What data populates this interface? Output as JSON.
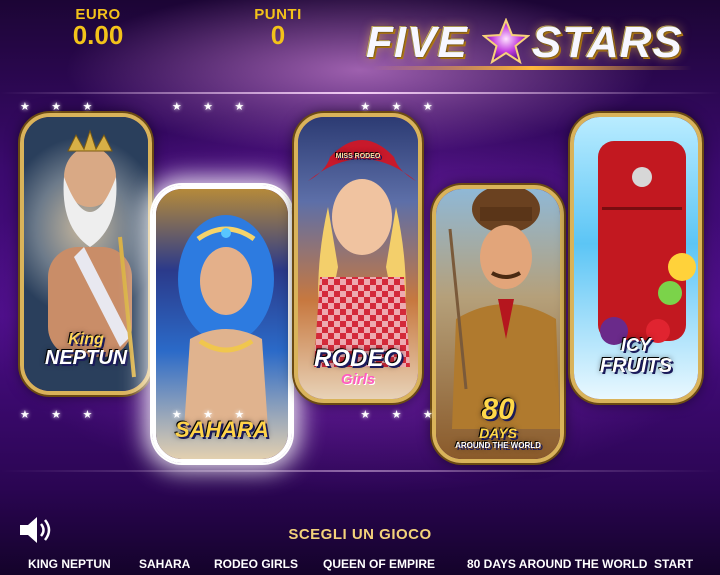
{
  "hud": {
    "credit_label": "EURO",
    "credit_value": "0.00",
    "points_label": "PUNTI",
    "points_value": "0"
  },
  "logo": {
    "left_word": "FIVE",
    "right_word": "STARS"
  },
  "games": [
    {
      "title_line1": "King",
      "title_line2": "NEPTUN",
      "selected": false
    },
    {
      "title_line1": "SAHARA",
      "selected": true
    },
    {
      "title_line1": "RODEO",
      "title_line2": "Girls",
      "badge": "MISS RODEO",
      "selected": false
    },
    {
      "title_line1": "80",
      "title_line2": "DAYS",
      "title_line3": "AROUND THE WORLD",
      "selected": false
    },
    {
      "title_line1": "ICY",
      "title_line2": "FRUITS",
      "selected": false
    }
  ],
  "prompt": "SCEGLI UN GIOCO",
  "menu": {
    "items": [
      "KING NEPTUN",
      "SAHARA",
      "RODEO GIRLS",
      "QUEEN OF EMPIRE",
      "80 DAYS AROUND THE WORLD",
      "START"
    ]
  },
  "icons": {
    "sound": "speaker-icon",
    "logo_star": "star-icon"
  },
  "colors": {
    "accent_gold": "#f3c21a",
    "background": "#3b0a6e",
    "selected_glow": "#ffffff"
  }
}
